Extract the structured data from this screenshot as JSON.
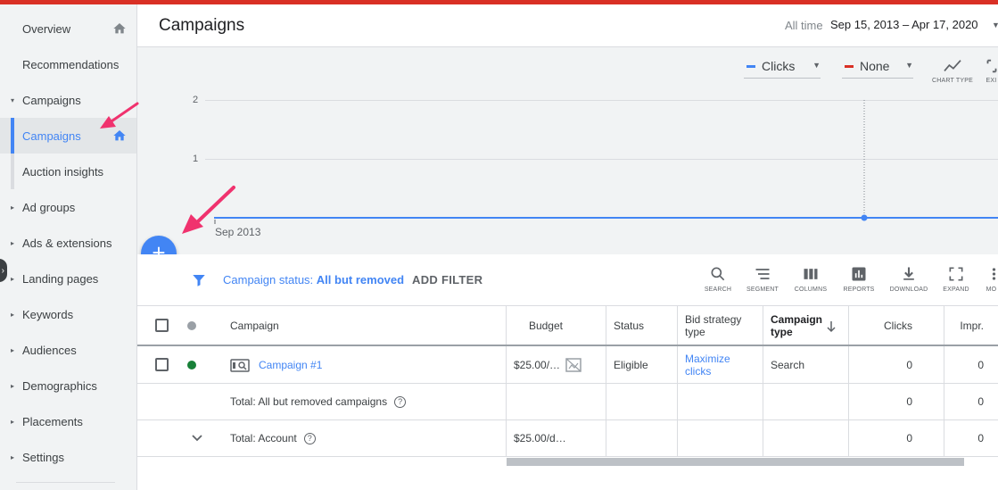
{
  "sidebar": {
    "items": [
      {
        "label": "Overview",
        "home": true
      },
      {
        "label": "Recommendations"
      },
      {
        "label": "Campaigns",
        "caret": "▾"
      },
      {
        "label": "Campaigns",
        "home": true,
        "selected": true
      },
      {
        "label": "Auction insights"
      },
      {
        "label": "Ad groups",
        "caret": "▸"
      },
      {
        "label": "Ads & extensions",
        "caret": "▸"
      },
      {
        "label": "Landing pages",
        "caret": "▸"
      },
      {
        "label": "Keywords",
        "caret": "▸"
      },
      {
        "label": "Audiences",
        "caret": "▸"
      },
      {
        "label": "Demographics",
        "caret": "▸"
      },
      {
        "label": "Placements",
        "caret": "▸"
      },
      {
        "label": "Settings",
        "caret": "▸"
      }
    ]
  },
  "header": {
    "title": "Campaigns",
    "all_time": "All time",
    "date_range": "Sep 15, 2013 – Apr 17, 2020"
  },
  "chart": {
    "metric1": "Clicks",
    "metric2": "None",
    "metric1_color": "#4285f4",
    "metric2_color": "#d93025",
    "chart_type_label": "CHART TYPE",
    "expand_label": "EXI",
    "y_ticks": [
      "2",
      "1"
    ],
    "x_label": "Sep 2013"
  },
  "fab": {
    "label": "+"
  },
  "filter": {
    "status_prefix": "Campaign status:",
    "status_value": "All but removed",
    "add_filter": "ADD FILTER"
  },
  "toolbar": {
    "search": "SEARCH",
    "segment": "SEGMENT",
    "columns": "COLUMNS",
    "reports": "REPORTS",
    "download": "DOWNLOAD",
    "expand": "EXPAND",
    "more": "MO"
  },
  "table": {
    "headers": {
      "campaign": "Campaign",
      "budget": "Budget",
      "status": "Status",
      "bid_strategy_1": "Bid strategy",
      "bid_strategy_2": "type",
      "campaign_type_1": "Campaign",
      "campaign_type_2": "type",
      "clicks": "Clicks",
      "impr": "Impr."
    },
    "rows": [
      {
        "campaign": "Campaign #1",
        "budget": "$25.00/…",
        "status": "Eligible",
        "bid_1": "Maximize",
        "bid_2": "clicks",
        "type": "Search",
        "clicks": "0",
        "impr": "0",
        "status_color": "#188038"
      }
    ],
    "total_removed": {
      "label": "Total: All but removed campaigns",
      "clicks": "0",
      "impr": "0"
    },
    "total_account": {
      "label": "Total: Account",
      "budget": "$25.00/d…",
      "clicks": "0",
      "impr": "0"
    }
  },
  "colors": {
    "accent": "#4285f4",
    "brand_red": "#d93025",
    "annotation_arrow": "#f0326e"
  }
}
